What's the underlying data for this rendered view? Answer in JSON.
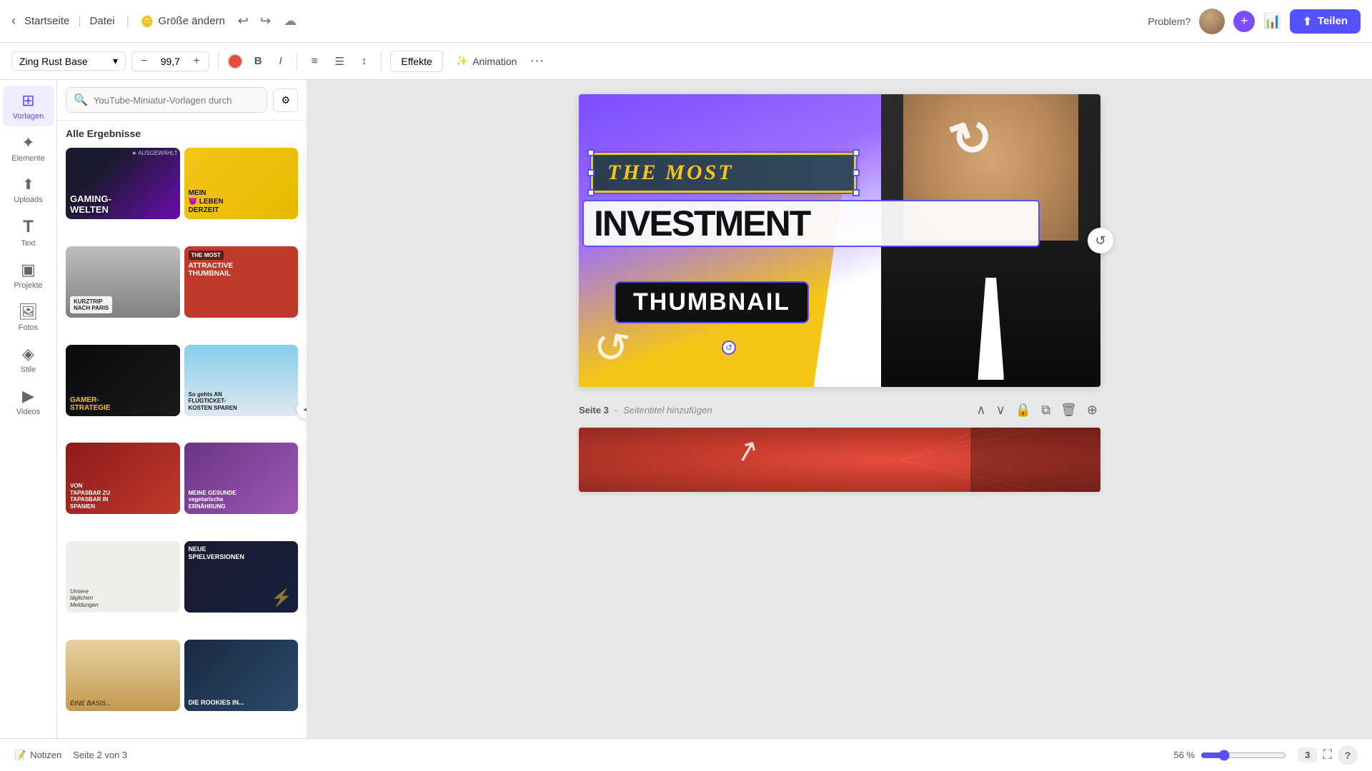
{
  "topbar": {
    "back_label": "←",
    "startseite": "Startseite",
    "datei": "Datei",
    "grosse": "Größe ändern",
    "problem": "Problem?",
    "share": "Teilen"
  },
  "toolbar": {
    "font_name": "Zing Rust Base",
    "font_size": "99,7",
    "effekte": "Effekte",
    "animation": "Animation"
  },
  "sidebar": {
    "items": [
      {
        "label": "Vorlagen",
        "icon": "⊞"
      },
      {
        "label": "Elemente",
        "icon": "✦"
      },
      {
        "label": "Uploads",
        "icon": "↑"
      },
      {
        "label": "Text",
        "icon": "T"
      },
      {
        "label": "Projekte",
        "icon": "▣"
      },
      {
        "label": "Fotos",
        "icon": "🖼"
      },
      {
        "label": "Stile",
        "icon": "◈"
      },
      {
        "label": "Videos",
        "icon": "▶"
      }
    ]
  },
  "panel": {
    "search_placeholder": "YouTube-Miniatur-Vorlagen durch",
    "title": "Alle Ergebnisse",
    "templates": [
      {
        "label": "GAMING-\nWELTEN",
        "class": "tmpl-1"
      },
      {
        "label": "MEIN\n😈 LEBEN\nDERZEIT",
        "class": "tmpl-2"
      },
      {
        "label": "KURZTRIP\nNACH PARIS",
        "class": "tmpl-3"
      },
      {
        "label": "THE MOST\nATTRACTIVE\nTHUMBNAIL",
        "class": "tmpl-4"
      },
      {
        "label": "GAMER-\nSTRATEGIE",
        "class": "tmpl-5"
      },
      {
        "label": "So gehts AN FLUGTICKET-\nKOSTEN SPAREN",
        "class": "tmpl-6"
      },
      {
        "label": "VON\nTAPASBAR ZU\nTAPASBAR IN\nSPANIEN",
        "class": "tmpl-7"
      },
      {
        "label": "MEINE GESUNDE\nvegetarische\nERNÄHRUNG",
        "class": "tmpl-8"
      },
      {
        "label": "Unsere\ntäglichen\nMeldungen",
        "class": "tmpl-9"
      },
      {
        "label": "NEUE\nSPIELVERSIONEN",
        "class": "tmpl-10"
      },
      {
        "label": "EINE BASIS...",
        "class": "tmpl-11"
      },
      {
        "label": "DIE ROOKIES IN...",
        "class": "tmpl-12"
      }
    ]
  },
  "canvas": {
    "texts": {
      "the_most": "THE MOST",
      "investment": "INVESTMENT",
      "thumbnail": "THUMBNAIL"
    }
  },
  "page_separator": {
    "label": "Seite 3",
    "subtitle": "Seitentitel hinzufügen"
  },
  "bottombar": {
    "notes": "Notizen",
    "page_info": "Seite 2 von 3",
    "zoom": "56 %",
    "pages_indicator": "3"
  }
}
